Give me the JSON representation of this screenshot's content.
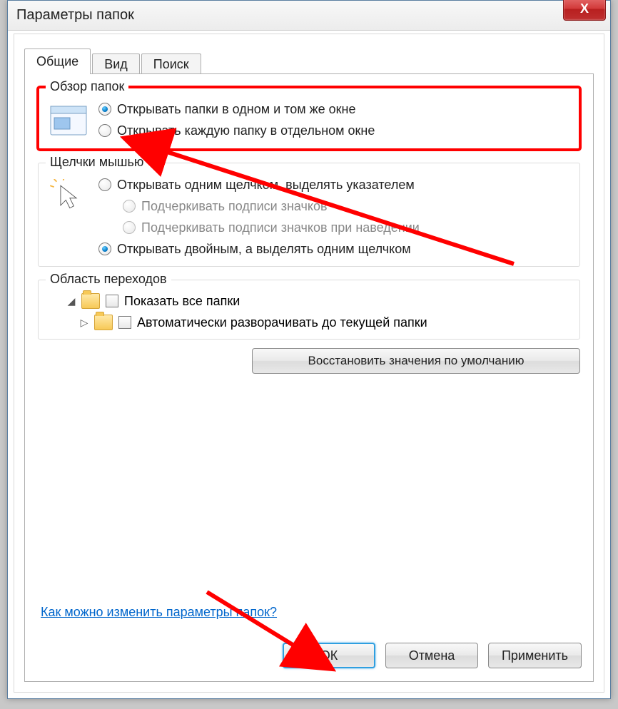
{
  "window": {
    "title": "Параметры папок",
    "close_glyph": "X"
  },
  "tabs": {
    "general": "Общие",
    "view": "Вид",
    "search": "Поиск"
  },
  "group_browse": {
    "title": "Обзор папок",
    "opt_same_window": "Открывать папки в одном и том же окне",
    "opt_separate_window": "Открывать каждую папку в отдельном окне"
  },
  "group_clicks": {
    "title": "Щелчки мышью",
    "opt_single_click": "Открывать одним щелчком, выделять указателем",
    "opt_underline_always": "Подчеркивать подписи значков",
    "opt_underline_hover": "Подчеркивать подписи значков при наведении",
    "opt_double_click": "Открывать двойным, а выделять одним щелчком"
  },
  "group_nav": {
    "title": "Область переходов",
    "opt_show_all": "Показать все папки",
    "opt_auto_expand": "Автоматически разворачивать до текущей папки"
  },
  "restore_defaults": "Восстановить значения по умолчанию",
  "help_link": "Как можно изменить параметры папок?",
  "buttons": {
    "ok": "ОК",
    "cancel": "Отмена",
    "apply": "Применить"
  },
  "state": {
    "browse_selected": "same_window",
    "clicks_selected": "double_click",
    "show_all_checked": false,
    "auto_expand_checked": false
  }
}
